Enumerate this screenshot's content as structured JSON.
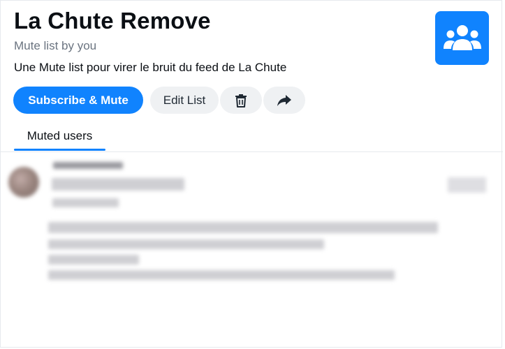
{
  "list": {
    "title": "La Chute Remove",
    "subtitle": "Mute list by you",
    "description": "Une Mute list pour virer le bruit du feed de La Chute",
    "avatar_icon": "users-group-icon",
    "accent_color": "#1083fe"
  },
  "actions": {
    "subscribe_label": "Subscribe & Mute",
    "edit_label": "Edit List",
    "delete_icon": "trash-icon",
    "share_icon": "share-arrow-icon"
  },
  "tabs": [
    {
      "label": "Muted users",
      "active": true
    }
  ],
  "muted_users": [
    {
      "obscured": true
    }
  ]
}
